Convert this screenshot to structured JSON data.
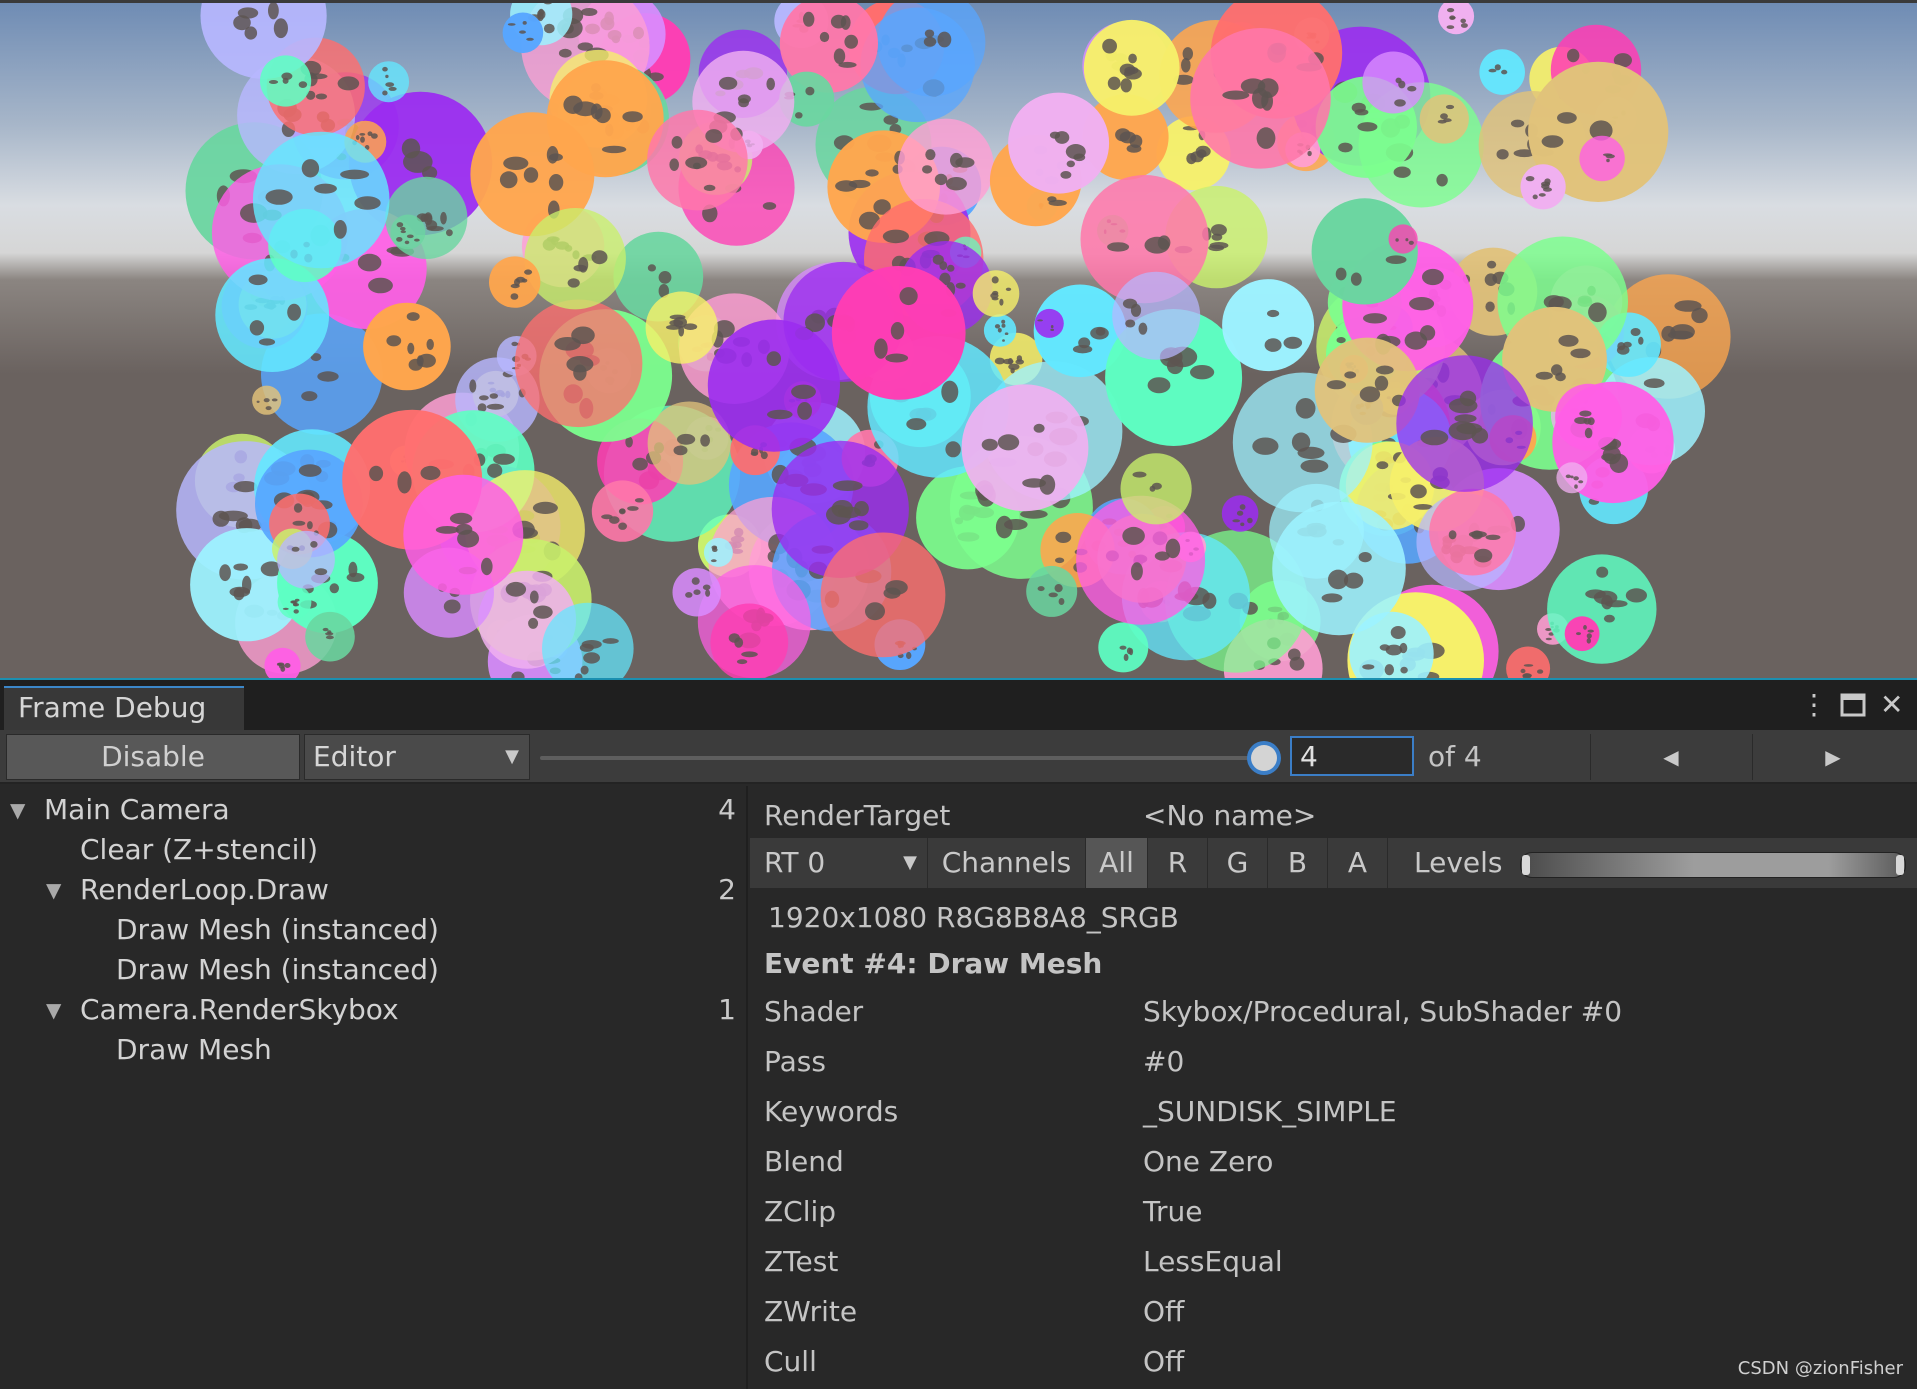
{
  "panel": {
    "tab_title": "Frame Debug",
    "window_buttons": [
      "more-options",
      "maximize",
      "close"
    ]
  },
  "toolbar": {
    "disable_label": "Disable",
    "target_label": "Editor",
    "event_index": "4",
    "of_label": "of 4",
    "slider_fraction": 1.0,
    "prev_label": "◀",
    "next_label": "▶"
  },
  "tree": {
    "rows": [
      {
        "label": "Main Camera",
        "count": "4",
        "expanded": true,
        "depth": 0
      },
      {
        "label": "Clear (Z+stencil)",
        "count": "",
        "expanded": null,
        "depth": 1
      },
      {
        "label": "RenderLoop.Draw",
        "count": "2",
        "expanded": true,
        "depth": 1
      },
      {
        "label": "Draw Mesh (instanced)",
        "count": "",
        "expanded": null,
        "depth": 2
      },
      {
        "label": "Draw Mesh (instanced)",
        "count": "",
        "expanded": null,
        "depth": 2
      },
      {
        "label": "Camera.RenderSkybox",
        "count": "1",
        "expanded": true,
        "depth": 1
      },
      {
        "label": "Draw Mesh",
        "count": "",
        "expanded": null,
        "depth": 2
      }
    ]
  },
  "details": {
    "render_target_label": "RenderTarget",
    "render_target_value": "<No name>",
    "rt_select": "RT 0",
    "channels_label": "Channels",
    "channels": [
      "All",
      "R",
      "G",
      "B",
      "A"
    ],
    "active_channel": "All",
    "levels_label": "Levels",
    "format": "1920x1080 R8G8B8A8_SRGB",
    "event_title": "Event #4: Draw Mesh",
    "props": [
      {
        "key": "Shader",
        "value": "Skybox/Procedural, SubShader #0"
      },
      {
        "key": "Pass",
        "value": "#0"
      },
      {
        "key": "Keywords",
        "value": "_SUNDISK_SIMPLE"
      },
      {
        "key": "Blend",
        "value": "One Zero"
      },
      {
        "key": "ZClip",
        "value": "True"
      },
      {
        "key": "ZTest",
        "value": "LessEqual"
      },
      {
        "key": "ZWrite",
        "value": "Off"
      },
      {
        "key": "Cull",
        "value": "Off"
      }
    ]
  },
  "watermark": "CSDN @zionFisher",
  "colors": {
    "accent": "#3b7ec7",
    "panel_bg": "#282828",
    "toolbar_bg": "#3c3c3c",
    "text": "#c4c4c4"
  }
}
